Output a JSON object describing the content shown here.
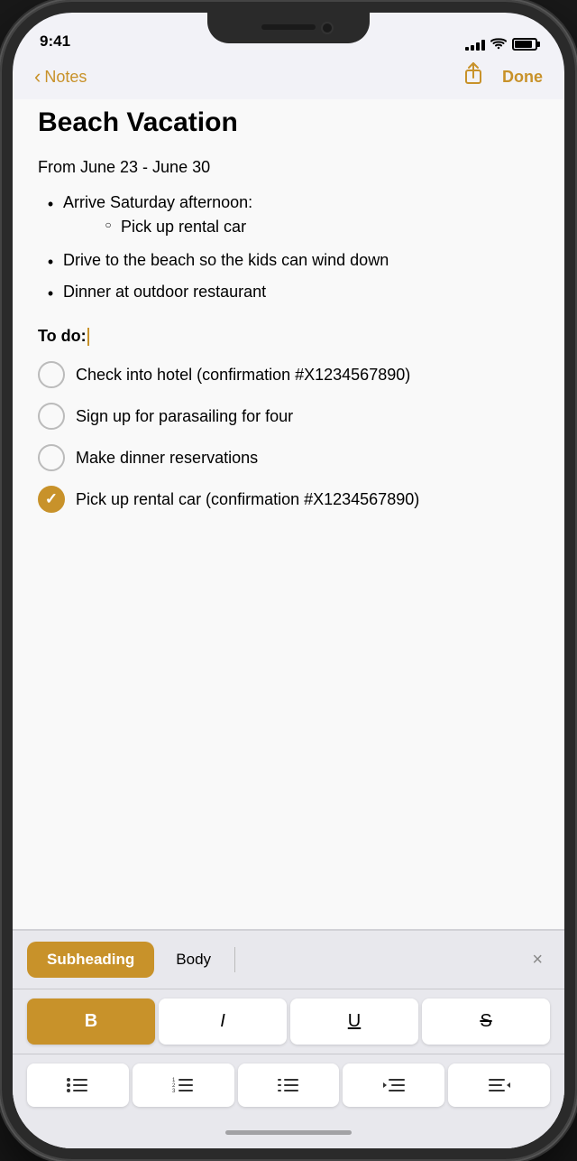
{
  "status": {
    "time": "9:41",
    "signal_bars": [
      3,
      6,
      9,
      12,
      14
    ],
    "battery_level": 85
  },
  "nav": {
    "back_label": "Notes",
    "share_icon": "↑",
    "done_label": "Done"
  },
  "note": {
    "title": "Beach Vacation",
    "date_line": "From June 23 - June 30",
    "bullets": [
      {
        "text": "Arrive Saturday afternoon:",
        "sub_bullets": [
          "Pick up rental car"
        ]
      },
      {
        "text": "Drive to the beach so the kids can wind down",
        "sub_bullets": []
      },
      {
        "text": "Dinner at outdoor restaurant",
        "sub_bullets": []
      }
    ],
    "todo_heading": "To do:",
    "todos": [
      {
        "text": "Check into hotel (confirmation #X1234567890)",
        "checked": false
      },
      {
        "text": "Sign up for parasailing for four",
        "checked": false
      },
      {
        "text": "Make dinner reservations",
        "checked": false
      },
      {
        "text": "Pick up rental car (confirmation #X1234567890)",
        "checked": true
      }
    ]
  },
  "format_toolbar": {
    "subheading_label": "Subheading",
    "body_label": "Body",
    "close_icon": "×"
  },
  "style_toolbar": {
    "bold_label": "B",
    "italic_label": "I",
    "underline_label": "U",
    "strikethrough_label": "S"
  },
  "list_toolbar": {
    "bullets_icon": "≡",
    "numbered_icon": "≡",
    "dashes_icon": "≡",
    "indent_left_icon": "<≡",
    "indent_right_icon": "≡>"
  },
  "colors": {
    "accent": "#c8922a",
    "accent_active": "#d4982e"
  }
}
